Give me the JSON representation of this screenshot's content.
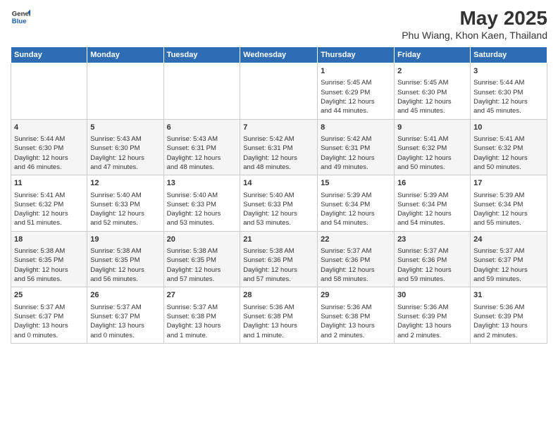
{
  "header": {
    "logo_line1": "General",
    "logo_line2": "Blue",
    "title": "May 2025",
    "subtitle": "Phu Wiang, Khon Kaen, Thailand"
  },
  "weekdays": [
    "Sunday",
    "Monday",
    "Tuesday",
    "Wednesday",
    "Thursday",
    "Friday",
    "Saturday"
  ],
  "weeks": [
    [
      {
        "day": "",
        "info": ""
      },
      {
        "day": "",
        "info": ""
      },
      {
        "day": "",
        "info": ""
      },
      {
        "day": "",
        "info": ""
      },
      {
        "day": "1",
        "info": "Sunrise: 5:45 AM\nSunset: 6:29 PM\nDaylight: 12 hours\nand 44 minutes."
      },
      {
        "day": "2",
        "info": "Sunrise: 5:45 AM\nSunset: 6:30 PM\nDaylight: 12 hours\nand 45 minutes."
      },
      {
        "day": "3",
        "info": "Sunrise: 5:44 AM\nSunset: 6:30 PM\nDaylight: 12 hours\nand 45 minutes."
      }
    ],
    [
      {
        "day": "4",
        "info": "Sunrise: 5:44 AM\nSunset: 6:30 PM\nDaylight: 12 hours\nand 46 minutes."
      },
      {
        "day": "5",
        "info": "Sunrise: 5:43 AM\nSunset: 6:30 PM\nDaylight: 12 hours\nand 47 minutes."
      },
      {
        "day": "6",
        "info": "Sunrise: 5:43 AM\nSunset: 6:31 PM\nDaylight: 12 hours\nand 48 minutes."
      },
      {
        "day": "7",
        "info": "Sunrise: 5:42 AM\nSunset: 6:31 PM\nDaylight: 12 hours\nand 48 minutes."
      },
      {
        "day": "8",
        "info": "Sunrise: 5:42 AM\nSunset: 6:31 PM\nDaylight: 12 hours\nand 49 minutes."
      },
      {
        "day": "9",
        "info": "Sunrise: 5:41 AM\nSunset: 6:32 PM\nDaylight: 12 hours\nand 50 minutes."
      },
      {
        "day": "10",
        "info": "Sunrise: 5:41 AM\nSunset: 6:32 PM\nDaylight: 12 hours\nand 50 minutes."
      }
    ],
    [
      {
        "day": "11",
        "info": "Sunrise: 5:41 AM\nSunset: 6:32 PM\nDaylight: 12 hours\nand 51 minutes."
      },
      {
        "day": "12",
        "info": "Sunrise: 5:40 AM\nSunset: 6:33 PM\nDaylight: 12 hours\nand 52 minutes."
      },
      {
        "day": "13",
        "info": "Sunrise: 5:40 AM\nSunset: 6:33 PM\nDaylight: 12 hours\nand 53 minutes."
      },
      {
        "day": "14",
        "info": "Sunrise: 5:40 AM\nSunset: 6:33 PM\nDaylight: 12 hours\nand 53 minutes."
      },
      {
        "day": "15",
        "info": "Sunrise: 5:39 AM\nSunset: 6:34 PM\nDaylight: 12 hours\nand 54 minutes."
      },
      {
        "day": "16",
        "info": "Sunrise: 5:39 AM\nSunset: 6:34 PM\nDaylight: 12 hours\nand 54 minutes."
      },
      {
        "day": "17",
        "info": "Sunrise: 5:39 AM\nSunset: 6:34 PM\nDaylight: 12 hours\nand 55 minutes."
      }
    ],
    [
      {
        "day": "18",
        "info": "Sunrise: 5:38 AM\nSunset: 6:35 PM\nDaylight: 12 hours\nand 56 minutes."
      },
      {
        "day": "19",
        "info": "Sunrise: 5:38 AM\nSunset: 6:35 PM\nDaylight: 12 hours\nand 56 minutes."
      },
      {
        "day": "20",
        "info": "Sunrise: 5:38 AM\nSunset: 6:35 PM\nDaylight: 12 hours\nand 57 minutes."
      },
      {
        "day": "21",
        "info": "Sunrise: 5:38 AM\nSunset: 6:36 PM\nDaylight: 12 hours\nand 57 minutes."
      },
      {
        "day": "22",
        "info": "Sunrise: 5:37 AM\nSunset: 6:36 PM\nDaylight: 12 hours\nand 58 minutes."
      },
      {
        "day": "23",
        "info": "Sunrise: 5:37 AM\nSunset: 6:36 PM\nDaylight: 12 hours\nand 59 minutes."
      },
      {
        "day": "24",
        "info": "Sunrise: 5:37 AM\nSunset: 6:37 PM\nDaylight: 12 hours\nand 59 minutes."
      }
    ],
    [
      {
        "day": "25",
        "info": "Sunrise: 5:37 AM\nSunset: 6:37 PM\nDaylight: 13 hours\nand 0 minutes."
      },
      {
        "day": "26",
        "info": "Sunrise: 5:37 AM\nSunset: 6:37 PM\nDaylight: 13 hours\nand 0 minutes."
      },
      {
        "day": "27",
        "info": "Sunrise: 5:37 AM\nSunset: 6:38 PM\nDaylight: 13 hours\nand 1 minute."
      },
      {
        "day": "28",
        "info": "Sunrise: 5:36 AM\nSunset: 6:38 PM\nDaylight: 13 hours\nand 1 minute."
      },
      {
        "day": "29",
        "info": "Sunrise: 5:36 AM\nSunset: 6:38 PM\nDaylight: 13 hours\nand 2 minutes."
      },
      {
        "day": "30",
        "info": "Sunrise: 5:36 AM\nSunset: 6:39 PM\nDaylight: 13 hours\nand 2 minutes."
      },
      {
        "day": "31",
        "info": "Sunrise: 5:36 AM\nSunset: 6:39 PM\nDaylight: 13 hours\nand 2 minutes."
      }
    ]
  ]
}
